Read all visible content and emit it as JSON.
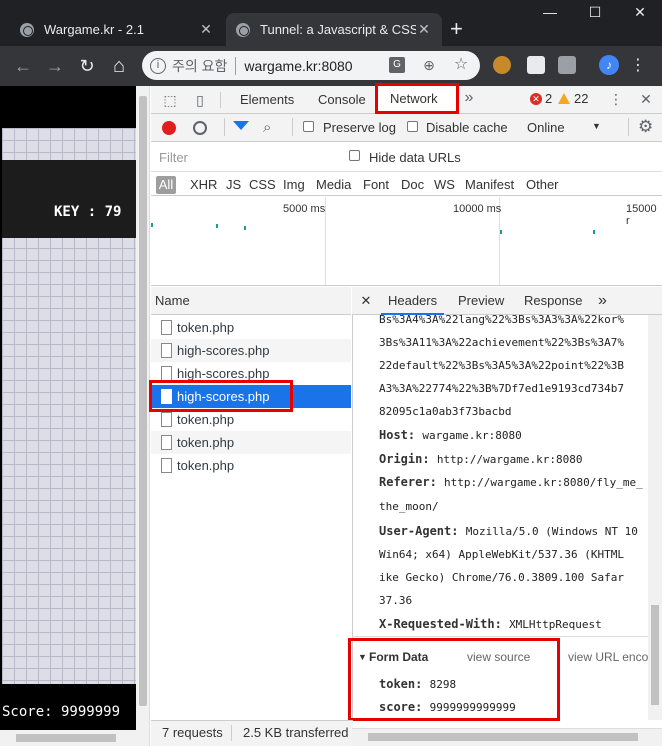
{
  "browser": {
    "tabs": [
      {
        "title": "Wargame.kr - 2.1",
        "close": "✕"
      },
      {
        "title": "Tunnel: a Javascript & CSS",
        "close": "✕"
      }
    ],
    "new_tab": "+",
    "window": {
      "minimize": "—",
      "maximize": "☐",
      "close": "✕"
    },
    "nav": {
      "back": "←",
      "forward": "→",
      "reload": "↻",
      "home": "⌂"
    },
    "omnibox": {
      "security_warning": "주의 요함",
      "url": "wargame.kr:8080"
    },
    "profile_initial": "♪",
    "menu": "⋮"
  },
  "page": {
    "key_text": "KEY  :  79",
    "score_text": "Score: 9999999"
  },
  "devtools": {
    "tabs": [
      "Elements",
      "Console",
      "Network"
    ],
    "more_tabs": "»",
    "errors": "2",
    "warnings": "22",
    "menu": "⋮",
    "close": "✕",
    "toolbar": {
      "preserve_log": "Preserve log",
      "disable_cache": "Disable cache",
      "throttle": "Online",
      "throttle_arrow": "▼"
    },
    "filter": {
      "placeholder": "Filter",
      "hide_data_urls": "Hide data URLs"
    },
    "types": [
      "All",
      "XHR",
      "JS",
      "CSS",
      "Img",
      "Media",
      "Font",
      "Doc",
      "WS",
      "Manifest",
      "Other"
    ],
    "timeline_labels": [
      "5000 ms",
      "10000 ms",
      "15000 r"
    ],
    "list_header": "Name",
    "requests": [
      {
        "name": "token.php"
      },
      {
        "name": "high-scores.php"
      },
      {
        "name": "high-scores.php"
      },
      {
        "name": "high-scores.php"
      },
      {
        "name": "token.php"
      },
      {
        "name": "token.php"
      },
      {
        "name": "token.php"
      }
    ],
    "detail_tabs": [
      "Headers",
      "Preview",
      "Response"
    ],
    "detail_close": "✕",
    "cookie_lines": [
      "Bs%3A4%3A%22lang%22%3Bs%3A3%3A%22kor%",
      "3Bs%3A11%3A%22achievement%22%3Bs%3A7%",
      "22default%22%3Bs%3A5%3A%22point%22%3B",
      "A3%3A%22774%22%3B%7Df7ed1e9193cd734b7",
      "82095c1a0ab3f73bacbd"
    ],
    "headers": [
      {
        "key": "Host:",
        "value": "wargame.kr:8080"
      },
      {
        "key": "Origin:",
        "value": "http://wargame.kr:8080"
      },
      {
        "key": "Referer:",
        "value": "http://wargame.kr:8080/fly_me_"
      },
      {
        "key": "",
        "value": "the_moon/"
      },
      {
        "key": "User-Agent:",
        "value": "Mozilla/5.0 (Windows NT 10"
      },
      {
        "key": "",
        "value": "Win64; x64) AppleWebKit/537.36 (KHTML"
      },
      {
        "key": "",
        "value": "ike Gecko) Chrome/76.0.3809.100 Safar"
      },
      {
        "key": "",
        "value": "37.36"
      },
      {
        "key": "X-Requested-With:",
        "value": "XMLHttpRequest"
      }
    ],
    "form_data": {
      "title": "Form Data",
      "view_source": "view source",
      "view_url": "view URL enco",
      "fields": [
        {
          "key": "token:",
          "value": "8298"
        },
        {
          "key": "score:",
          "value": "9999999999999"
        }
      ]
    },
    "status": {
      "requests": "7 requests",
      "transferred": "2.5 KB transferred"
    }
  }
}
